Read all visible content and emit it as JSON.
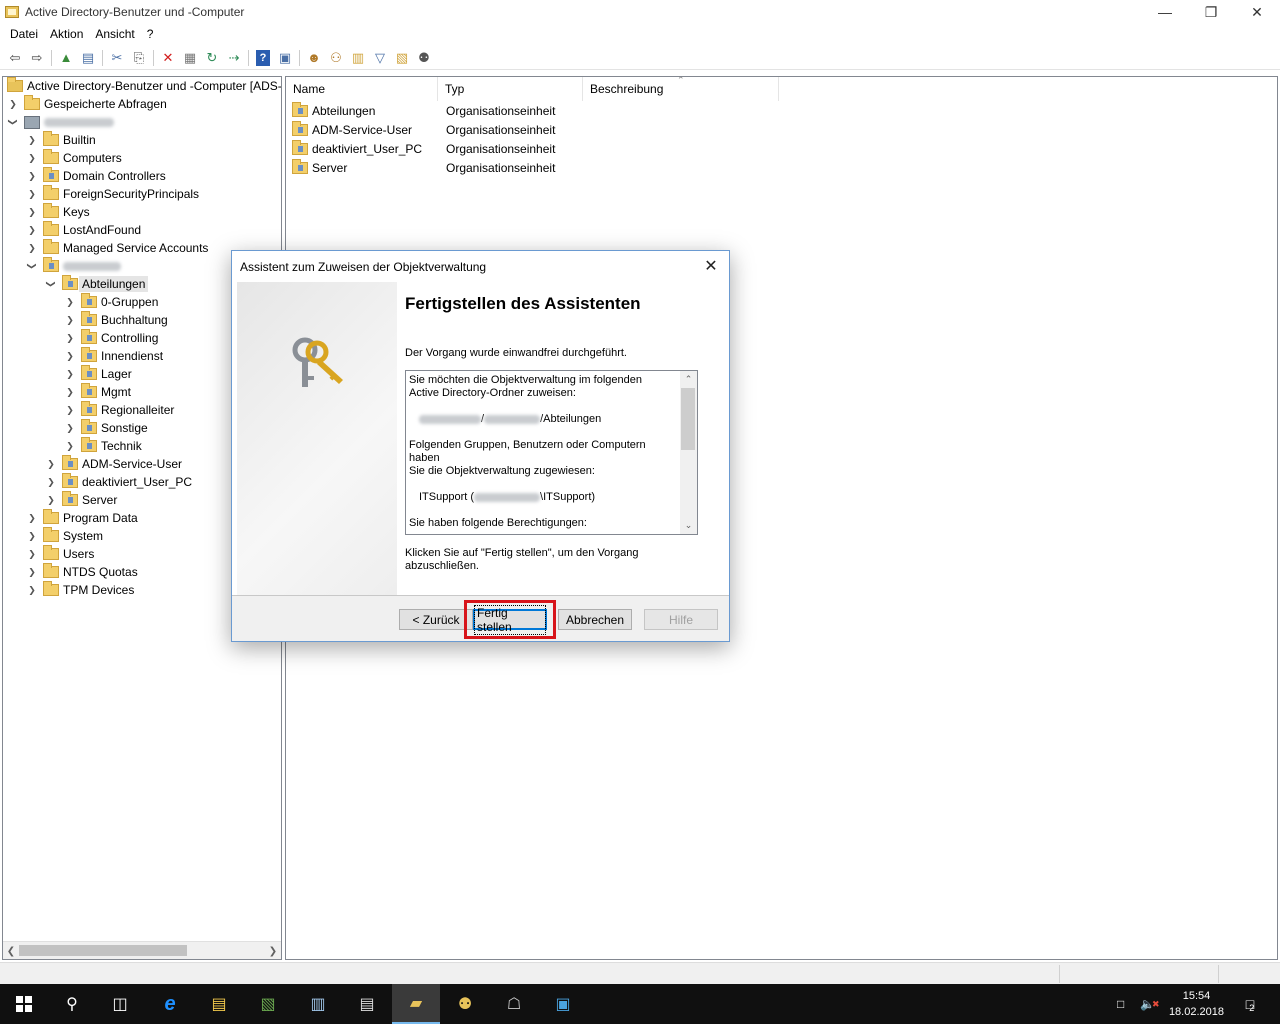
{
  "window": {
    "title": "Active Directory-Benutzer und -Computer",
    "controls": {
      "minimize": "—",
      "restore": "❐",
      "close": "✕"
    }
  },
  "menu": [
    "Datei",
    "Aktion",
    "Ansicht",
    "?"
  ],
  "tree": {
    "root": "Active Directory-Benutzer und -Computer [ADS-",
    "saved_queries": "Gespeicherte Abfragen",
    "domain_children": [
      "Builtin",
      "Computers",
      "Domain Controllers",
      "ForeignSecurityPrincipals",
      "Keys",
      "LostAndFound",
      "Managed Service Accounts"
    ],
    "selected": "Abteilungen",
    "abteilungen_children": [
      "0-Gruppen",
      "Buchhaltung",
      "Controlling",
      "Innendienst",
      "Lager",
      "Mgmt",
      "Regionalleiter",
      "Sonstige",
      "Technik"
    ],
    "ou_siblings": [
      "ADM-Service-User",
      "deaktiviert_User_PC",
      "Server"
    ],
    "domain_tail": [
      "Program Data",
      "System",
      "Users",
      "NTDS Quotas",
      "TPM Devices"
    ]
  },
  "list": {
    "columns": [
      "Name",
      "Typ",
      "Beschreibung"
    ],
    "rows": [
      {
        "name": "Abteilungen",
        "type": "Organisationseinheit"
      },
      {
        "name": "ADM-Service-User",
        "type": "Organisationseinheit"
      },
      {
        "name": "deaktiviert_User_PC",
        "type": "Organisationseinheit"
      },
      {
        "name": "Server",
        "type": "Organisationseinheit"
      }
    ]
  },
  "dialog": {
    "title": "Assistent zum Zuweisen der Objektverwaltung",
    "heading": "Fertigstellen des Assistenten",
    "success": "Der Vorgang wurde einwandfrei durchgeführt.",
    "summary": {
      "line1": "Sie möchten die Objektverwaltung im folgenden",
      "line2": "Active Directory-Ordner zuweisen:",
      "path_suffix": "/Abteilungen",
      "line3": "Folgenden Gruppen, Benutzern oder Computern haben",
      "line4": "Sie die Objektverwaltung zugewiesen:",
      "group_prefix": "ITSupport (",
      "group_suffix": "\\ITSupport)",
      "line5": "Sie haben folgende Berechtigungen:"
    },
    "finish_hint_1": "Klicken Sie auf \"Fertig stellen\", um den Vorgang",
    "finish_hint_2": "abzuschließen.",
    "buttons": {
      "back": "< Zurück",
      "finish": "Fertig stellen",
      "cancel": "Abbrechen",
      "help": "Hilfe"
    }
  },
  "taskbar": {
    "time": "15:54",
    "date": "18.02.2018",
    "notifications": "2"
  }
}
